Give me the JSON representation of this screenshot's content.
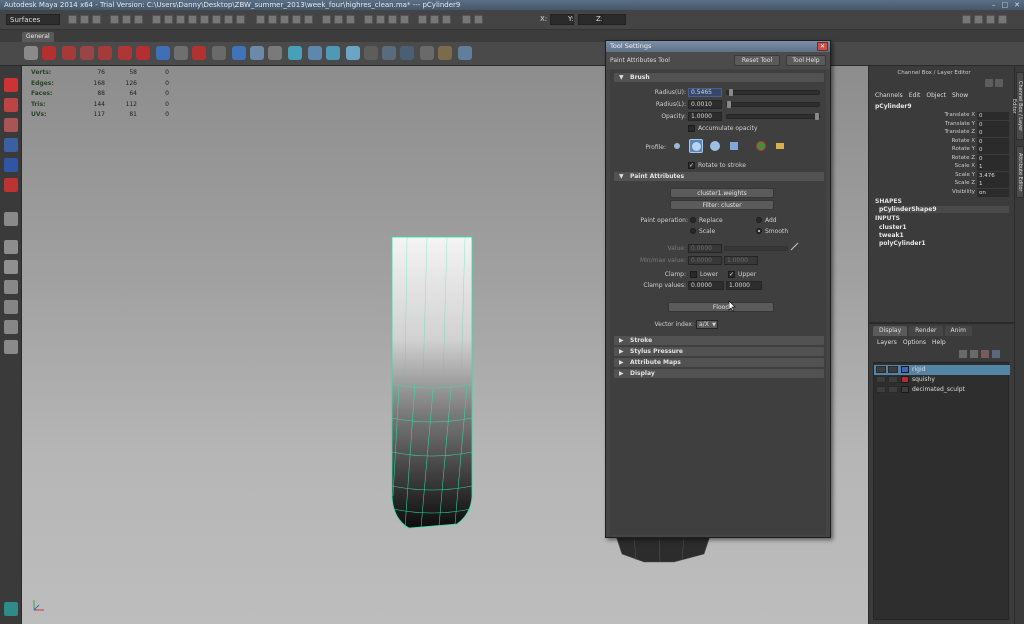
{
  "window": {
    "title": "Autodesk Maya 2014 x64 - Trial Version: C:\\Users\\Danny\\Desktop\\ZBW_summer_2013\\week_four\\highres_clean.ma* --- pCylinder9",
    "controls": [
      "–",
      "□",
      "✕"
    ]
  },
  "statusline": {
    "mode_menu": "Surfaces",
    "x_label": "X:",
    "y_label": "Y:",
    "z_label": "Z:"
  },
  "shelf": {
    "tab": "General"
  },
  "hud": {
    "rows": [
      {
        "label": "Verts:",
        "v1": "76",
        "v2": "58",
        "v3": "0"
      },
      {
        "label": "Edges:",
        "v1": "168",
        "v2": "126",
        "v3": "0"
      },
      {
        "label": "Faces:",
        "v1": "88",
        "v2": "64",
        "v3": "0"
      },
      {
        "label": "Tris:",
        "v1": "144",
        "v2": "112",
        "v3": "0"
      },
      {
        "label": "UVs:",
        "v1": "117",
        "v2": "81",
        "v3": "0"
      }
    ]
  },
  "tool_settings": {
    "title": "Tool Settings",
    "close": "✕",
    "tool_name": "Paint Attributes Tool",
    "reset_button": "Reset Tool",
    "help_button": "Tool Help",
    "brush": {
      "header": "Brush",
      "radius_u_label": "Radius(U):",
      "radius_u_value": "0.5465",
      "radius_l_label": "Radius(L):",
      "radius_l_value": "0.0010",
      "opacity_label": "Opacity:",
      "opacity_value": "1.0000",
      "accumulate_label": "Accumulate opacity",
      "profile_label": "Profile:",
      "rotate_label": "Rotate to stroke"
    },
    "paint_attributes": {
      "header": "Paint Attributes",
      "attribute_button": "cluster1.weights",
      "filter_button": "Filter: cluster",
      "operation_label": "Paint operation:",
      "op_replace": "Replace",
      "op_add": "Add",
      "op_scale": "Scale",
      "op_smooth": "Smooth",
      "value_label": "Value:",
      "value_value": "0.0000",
      "minmax_label": "Min/max value:",
      "min_value": "0.0000",
      "max_value": "1.0000",
      "clamp_label": "Clamp:",
      "clamp_lower": "Lower",
      "clamp_upper": "Upper",
      "clamp_values_label": "Clamp values:",
      "clamp_min": "0.0000",
      "clamp_max": "1.0000",
      "flood_button": "Flood",
      "vector_label": "Vector index:",
      "vector_value": "a/X"
    },
    "collapsed_sections": [
      "Stroke",
      "Stylus Pressure",
      "Attribute Maps",
      "Display"
    ]
  },
  "channel_box": {
    "title": "Channel Box / Layer Editor",
    "menus": [
      "Channels",
      "Edit",
      "Object",
      "Show"
    ],
    "object": "pCylinder9",
    "attributes": [
      {
        "name": "Translate X",
        "value": "0"
      },
      {
        "name": "Translate Y",
        "value": "0"
      },
      {
        "name": "Translate Z",
        "value": "0"
      },
      {
        "name": "Rotate X",
        "value": "0"
      },
      {
        "name": "Rotate Y",
        "value": "0"
      },
      {
        "name": "Rotate Z",
        "value": "0"
      },
      {
        "name": "Scale X",
        "value": "1"
      },
      {
        "name": "Scale Y",
        "value": "3.476"
      },
      {
        "name": "Scale Z",
        "value": "1"
      },
      {
        "name": "Visibility",
        "value": "on"
      }
    ],
    "shapes_header": "SHAPES",
    "shape": "pCylinderShape9",
    "inputs_header": "INPUTS",
    "inputs": [
      "cluster1",
      "tweak1",
      "polyCylinder1"
    ]
  },
  "side_tabs": [
    "Channel Box / Layer Editor",
    "Attribute Editor"
  ],
  "layer_editor": {
    "tabs": [
      "Display",
      "Render",
      "Anim"
    ],
    "menus": [
      "Layers",
      "Options",
      "Help"
    ],
    "layers": [
      {
        "name": "rigid",
        "color": "#3f63b8",
        "selected": true
      },
      {
        "name": "squishy",
        "color": "#b42a3a",
        "selected": false
      },
      {
        "name": "decimated_sculpt",
        "color": "#3d3d3d",
        "selected": false
      }
    ]
  }
}
